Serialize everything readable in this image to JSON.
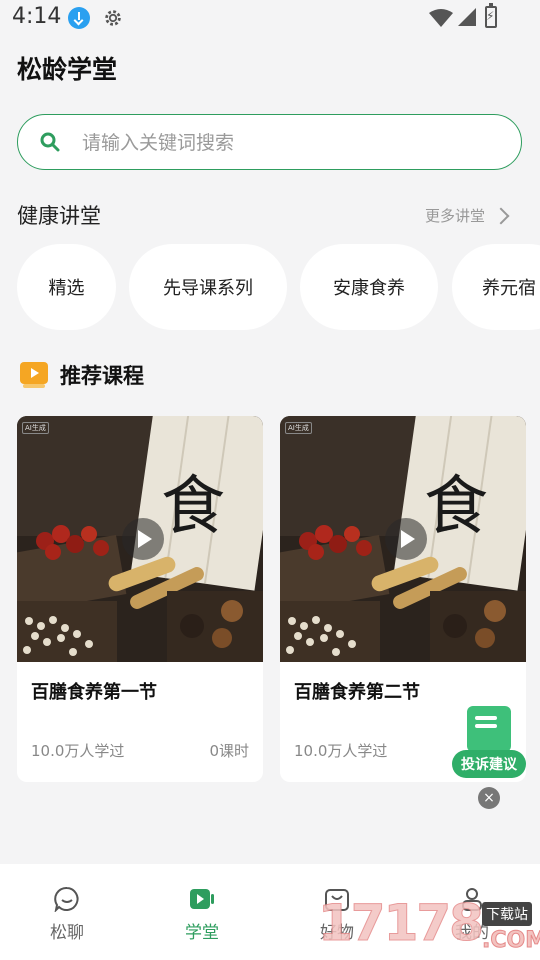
{
  "status_bar": {
    "time": "4:14"
  },
  "header": {
    "title": "松龄学堂"
  },
  "search": {
    "placeholder": "请输入关键词搜索"
  },
  "health_lectures": {
    "title": "健康讲堂",
    "more_label": "更多讲堂",
    "chips": [
      {
        "label": "精选"
      },
      {
        "label": "先导课系列"
      },
      {
        "label": "安康食养"
      },
      {
        "label": "养元宿"
      }
    ]
  },
  "recommended": {
    "title": "推荐课程",
    "courses": [
      {
        "title": "百膳食养第一节",
        "learners": "10.0万人学过",
        "lessons": "0课时",
        "tag": "AI生成",
        "sign_char": "食"
      },
      {
        "title": "百膳食养第二节",
        "learners": "10.0万人学过",
        "tag": "AI生成",
        "sign_char": "食"
      }
    ]
  },
  "feedback": {
    "label": "投诉建议",
    "close": "×"
  },
  "tabbar": {
    "items": [
      {
        "label": "松聊"
      },
      {
        "label": "学堂"
      },
      {
        "label": "好物"
      },
      {
        "label": "我的"
      }
    ],
    "active": "学堂"
  },
  "watermark": {
    "digits": "17178",
    "tag": "下载站",
    "suffix": ".COM"
  },
  "colors": {
    "accent": "#2e9d5e",
    "background": "#f4f4f5"
  }
}
